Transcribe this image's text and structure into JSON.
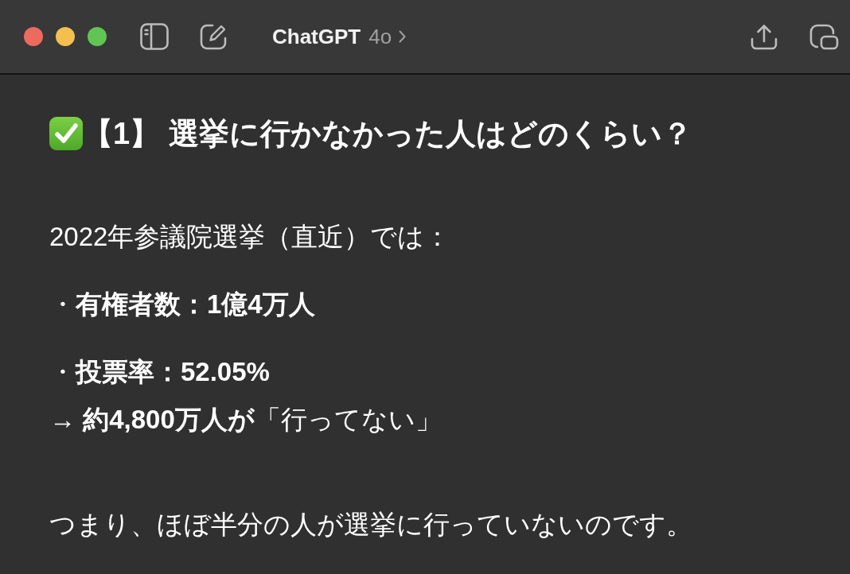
{
  "window": {
    "title": "ChatGPT",
    "model": "4o"
  },
  "message": {
    "sections": [
      {
        "blocks": [
          {
            "kind": "heading",
            "lines": [
              "【1】 選挙に行かなかった人はどのくらい？"
            ]
          }
        ]
      },
      {
        "blocks": [
          {
            "kind": "paragraph",
            "lines": [
              "2022年参議院選挙（直近）では："
            ]
          },
          {
            "kind": "paragraph",
            "lines": [
              "・**有権者数：1億4万人**"
            ]
          },
          {
            "kind": "paragraph",
            "lines": [
              "・**投票率：52.05%**",
              "→ **約4,800万人が**「行ってない」"
            ]
          }
        ]
      },
      {
        "blocks": [
          {
            "kind": "paragraph",
            "lines": [
              "つまり、ほぼ半分の人が選挙に行っていないのです。"
            ]
          }
        ]
      }
    ]
  }
}
